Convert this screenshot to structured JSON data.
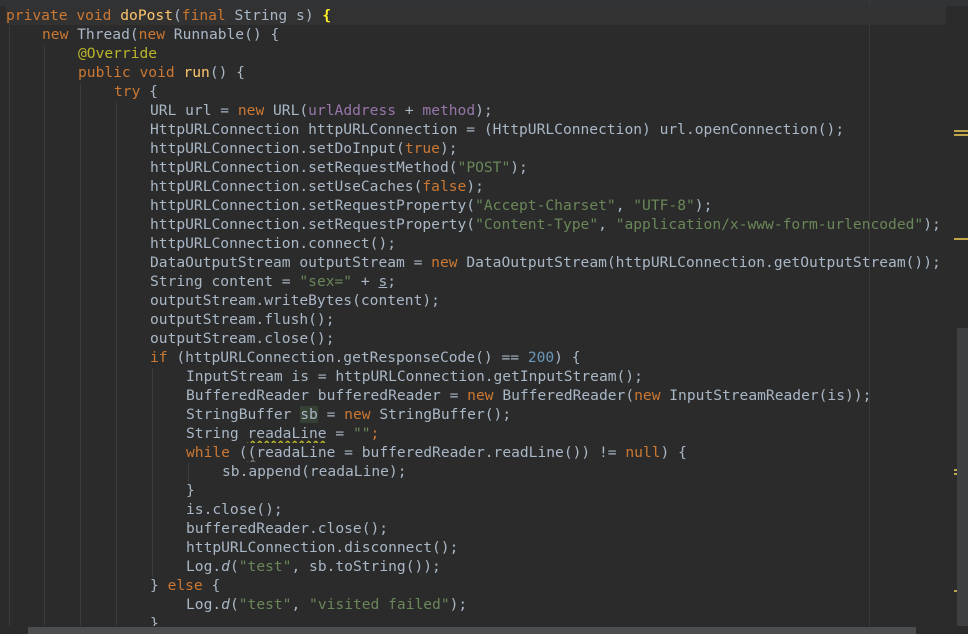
{
  "editor": {
    "language": "Java",
    "colors": {
      "background": "#2b2b2b",
      "text": "#a9b7c6",
      "keyword": "#cc7832",
      "method_declaration": "#ffc66d",
      "string": "#6a8759",
      "number": "#6897bb",
      "annotation": "#bbb529",
      "field": "#9876aa",
      "marker": "#bea54a"
    },
    "tokens": {
      "l1": [
        "private",
        " ",
        "void",
        " ",
        "doPost",
        "(",
        "final",
        " String ",
        "s",
        ") ",
        "{"
      ],
      "l2": [
        "new",
        " Thread(",
        "new",
        " Runnable() {"
      ],
      "l3": [
        "@Override"
      ],
      "l4": [
        "public",
        " ",
        "void",
        " ",
        "run",
        "() {"
      ],
      "l5": [
        "try",
        " {"
      ],
      "l6": [
        "URL url = ",
        "new",
        " URL(",
        "urlAddress",
        " + ",
        "method",
        ");"
      ],
      "l7": [
        "HttpURLConnection httpURLConnection = (HttpURLConnection) url.openConnection();"
      ],
      "l8": [
        "httpURLConnection.setDoInput(",
        "true",
        ");"
      ],
      "l9": [
        "httpURLConnection.setRequestMethod(",
        "\"POST\"",
        ");"
      ],
      "l10": [
        "httpURLConnection.setUseCaches(",
        "false",
        ");"
      ],
      "l11": [
        "httpURLConnection.setRequestProperty(",
        "\"Accept-Charset\"",
        ", ",
        "\"UTF-8\"",
        ");"
      ],
      "l12": [
        "httpURLConnection.setRequestProperty(",
        "\"Content-Type\"",
        ", ",
        "\"application/x-www-form-urlencoded\"",
        ");"
      ],
      "l13": [
        "httpURLConnection.connect();"
      ],
      "l14": [
        "DataOutputStream outputStream = ",
        "new",
        " DataOutputStream(httpURLConnection.getOutputStream());"
      ],
      "l15": [
        "String content = ",
        "\"sex=\"",
        " + ",
        "s",
        ";"
      ],
      "l16": [
        "outputStream.writeBytes(content);"
      ],
      "l17": [
        "outputStream.flush();"
      ],
      "l18": [
        "outputStream.close();"
      ],
      "l19": [
        "if",
        " (httpURLConnection.getResponseCode() == ",
        "200",
        ") {"
      ],
      "l20": [
        "InputStream is = httpURLConnection.getInputStream();"
      ],
      "l21": [
        "BufferedReader bufferedReader = ",
        "new",
        " BufferedReader(",
        "new",
        " InputStreamReader(is));"
      ],
      "l22": [
        "StringBuffer ",
        "sb",
        " = ",
        "new",
        " StringBuffer();"
      ],
      "l23": [
        "String ",
        "readaLine",
        " = ",
        "\"\"",
        ";"
      ],
      "l24": [
        "while",
        " (",
        "(",
        "readaLine = bufferedReader.readLine()) != ",
        "null",
        ") {"
      ],
      "l25": [
        "sb.append(readaLine);"
      ],
      "l26": [
        "}"
      ],
      "l27": [
        "is.close();"
      ],
      "l28": [
        "bufferedReader.close();"
      ],
      "l29": [
        "httpURLConnection.disconnect();"
      ],
      "l30": [
        "Log.",
        "d",
        "(",
        "\"test\"",
        ", sb.toString());"
      ],
      "l31": [
        "} ",
        "else",
        " {"
      ],
      "l32": [
        "Log.",
        "d",
        "(",
        "\"test\"",
        ", ",
        "\"visited failed\"",
        ");"
      ],
      "l33": [
        "}"
      ]
    }
  }
}
